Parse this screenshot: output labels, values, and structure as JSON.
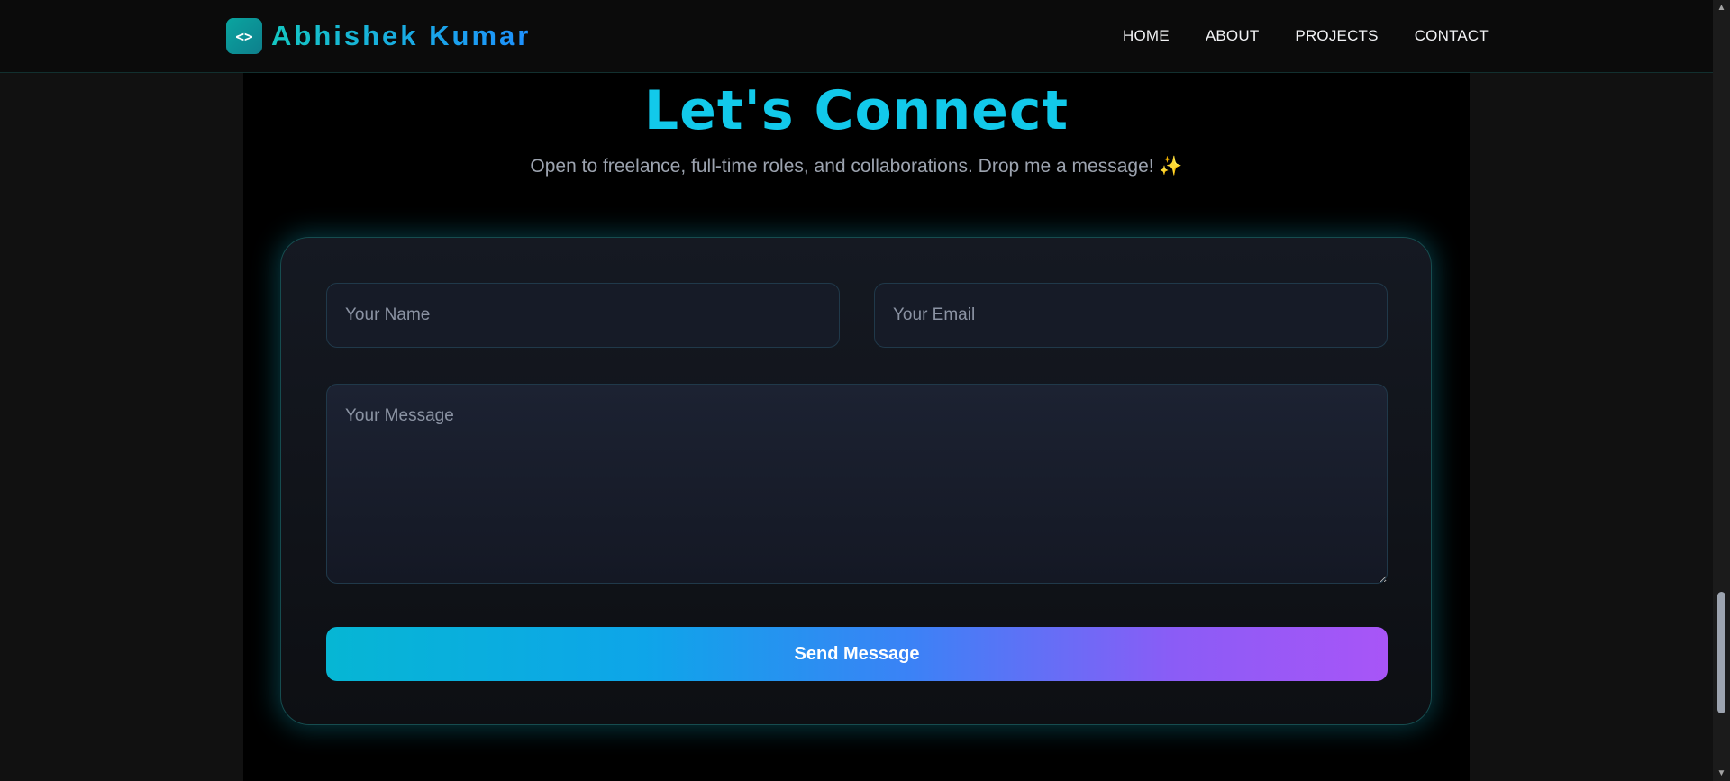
{
  "brand": {
    "logo_icon": "<>",
    "name": "Abhishek Kumar"
  },
  "nav": {
    "items": [
      "HOME",
      "ABOUT",
      "PROJECTS",
      "CONTACT"
    ]
  },
  "contact": {
    "title": "Let's Connect",
    "subtitle": "Open to freelance, full-time roles, and collaborations. Drop me a message! ✨",
    "name_placeholder": "Your Name",
    "email_placeholder": "Your Email",
    "message_placeholder": "Your Message",
    "send_label": "Send Message"
  },
  "scrollbar": {
    "up_glyph": "▲",
    "down_glyph": "▼",
    "position_fraction": 0.97
  },
  "colors": {
    "accent": "#12c9ea",
    "brand_gradient_start": "#14c7c2",
    "brand_gradient_end": "#1e90ff",
    "button_gradient_start": "#06b6d4",
    "button_gradient_end": "#a855f7",
    "background": "#000000"
  }
}
